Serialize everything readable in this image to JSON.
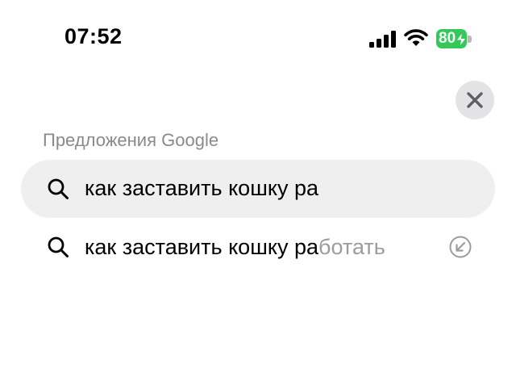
{
  "status_bar": {
    "time": "07:52",
    "battery_level": "80",
    "battery_color": "#34c759",
    "icons": [
      "cellular-signal-icon",
      "wifi-icon",
      "battery-charging-icon"
    ]
  },
  "close_button": {
    "icon": "close-icon"
  },
  "suggestions_header": "Предложения Google",
  "search": {
    "value": "как заставить кошку ра",
    "icon": "search-icon"
  },
  "suggestions": [
    {
      "typed": "как заставить кошку ра",
      "completion": "ботать",
      "icon": "search-icon",
      "action_icon": "fill-query-arrow-icon"
    }
  ]
}
